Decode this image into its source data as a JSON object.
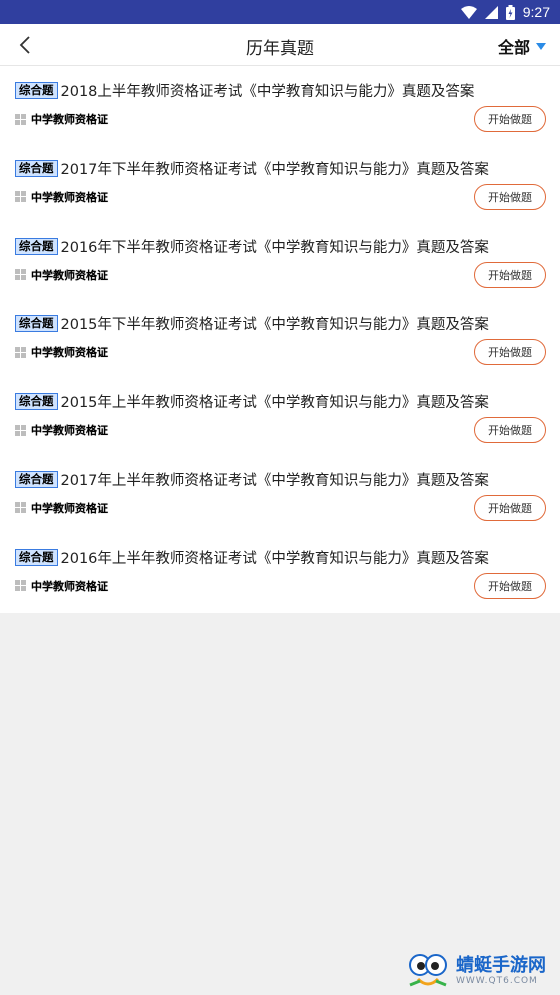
{
  "status": {
    "time": "9:27"
  },
  "header": {
    "title": "历年真题",
    "filter_label": "全部"
  },
  "colors": {
    "status_bar": "#303f9f",
    "tag_border": "#3a7be0",
    "button_border": "#e06a3a"
  },
  "items": [
    {
      "tag": "综合题",
      "title": "2018上半年教师资格证考试《中学教育知识与能力》真题及答案",
      "category": "中学教师资格证",
      "button": "开始做题"
    },
    {
      "tag": "综合题",
      "title": "2017年下半年教师资格证考试《中学教育知识与能力》真题及答案",
      "category": "中学教师资格证",
      "button": "开始做题"
    },
    {
      "tag": "综合题",
      "title": "2016年下半年教师资格证考试《中学教育知识与能力》真题及答案",
      "category": "中学教师资格证",
      "button": "开始做题"
    },
    {
      "tag": "综合题",
      "title": "2015年下半年教师资格证考试《中学教育知识与能力》真题及答案",
      "category": "中学教师资格证",
      "button": "开始做题"
    },
    {
      "tag": "综合题",
      "title": "2015年上半年教师资格证考试《中学教育知识与能力》真题及答案",
      "category": "中学教师资格证",
      "button": "开始做题"
    },
    {
      "tag": "综合题",
      "title": "2017年上半年教师资格证考试《中学教育知识与能力》真题及答案",
      "category": "中学教师资格证",
      "button": "开始做题"
    },
    {
      "tag": "综合题",
      "title": "2016年上半年教师资格证考试《中学教育知识与能力》真题及答案",
      "category": "中学教师资格证",
      "button": "开始做题"
    }
  ],
  "watermark": {
    "name": "蜻蜓手游网",
    "url": "WWW.QT6.COM"
  }
}
